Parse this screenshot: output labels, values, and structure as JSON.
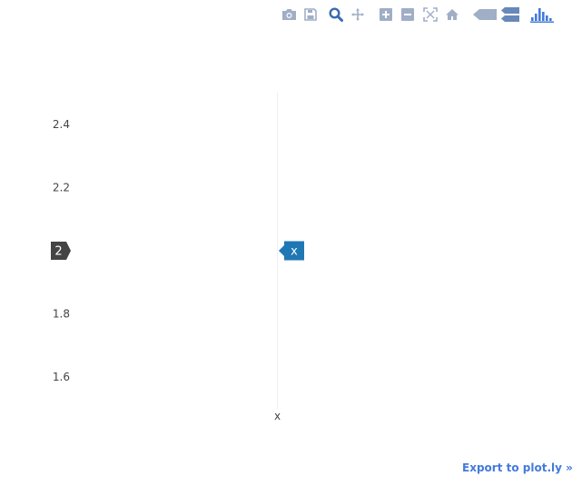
{
  "toolbar": {
    "icons": [
      "camera-icon",
      "save-icon",
      "zoom-icon",
      "pan-icon",
      "zoom-in-icon",
      "zoom-out-icon",
      "autoscale-icon",
      "reset-axes-icon",
      "hover-closest-icon",
      "hover-compare-icon",
      "plotly-logo-icon"
    ]
  },
  "chart_data": {
    "type": "scatter",
    "x_categories": [
      "x"
    ],
    "yticks": [
      "1.6",
      "1.8",
      "2",
      "2.2",
      "2.4"
    ],
    "ylim": [
      1.5,
      2.5
    ],
    "series": [
      {
        "x": [
          "x"
        ],
        "y": [
          2
        ]
      }
    ],
    "hover": {
      "x_label": "x",
      "y_label": "2"
    },
    "grid": true
  },
  "export": {
    "label": "Export to plot.ly »"
  },
  "colors": {
    "hover_y_bg": "#444444",
    "hover_x_bg": "#1f77b4",
    "modebar_icon": "#a0aec6",
    "modebar_active": "#3a6ab0",
    "export_link": "#447adb"
  }
}
